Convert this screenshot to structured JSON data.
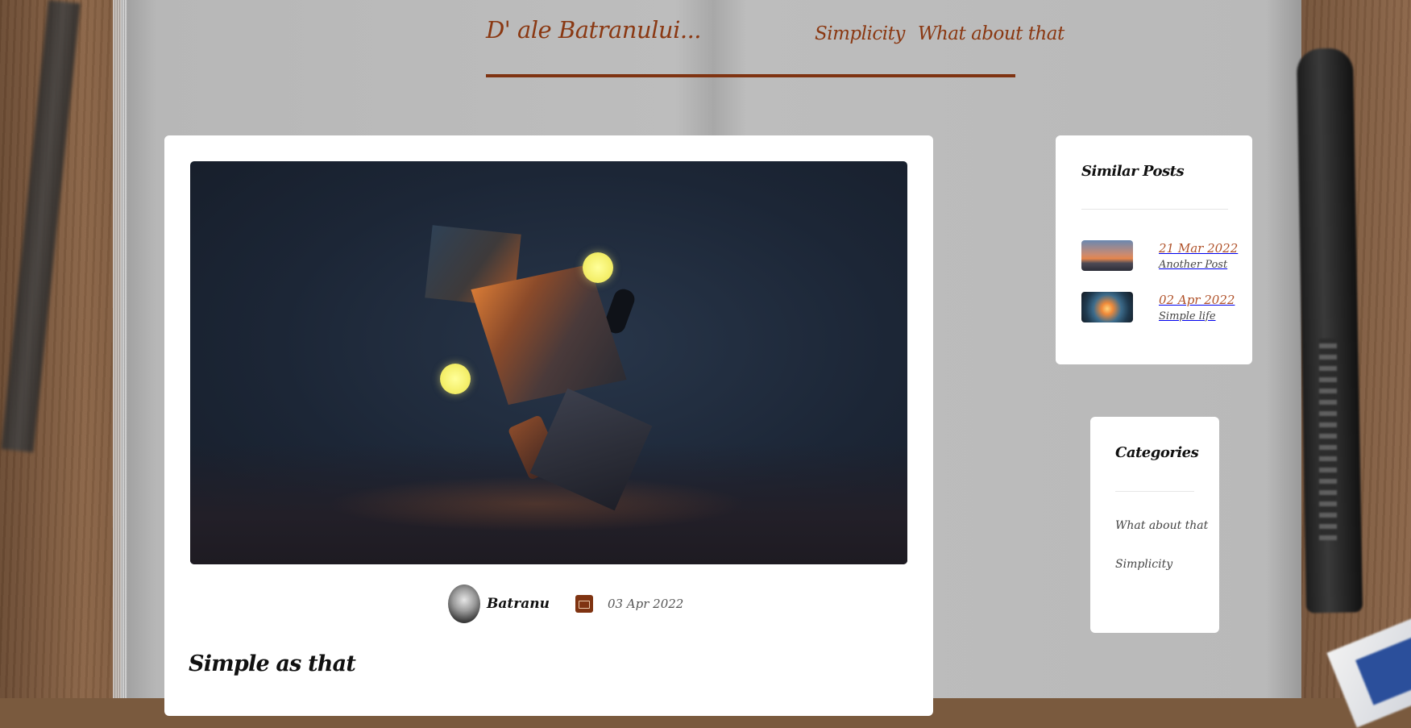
{
  "header": {
    "site_title": "D' ale Batranului...",
    "nav": [
      {
        "label": "Simplicity"
      },
      {
        "label": "What about that"
      }
    ]
  },
  "post": {
    "author": "Batranu",
    "date": "03 Apr 2022",
    "title": "Simple as that"
  },
  "sidebar": {
    "similar_posts": {
      "heading": "Similar Posts",
      "items": [
        {
          "date": "21 Mar 2022",
          "title": "Another Post"
        },
        {
          "date": "02 Apr 2022",
          "title": "Simple life"
        }
      ]
    },
    "categories": {
      "heading": "Categories",
      "items": [
        {
          "label": "What about that"
        },
        {
          "label": "Simplicity"
        }
      ]
    }
  },
  "colors": {
    "accent": "#8a3812",
    "date_accent": "#b0522a",
    "card": "#ffffff"
  },
  "icons": {
    "post_date": "calendar-icon"
  }
}
